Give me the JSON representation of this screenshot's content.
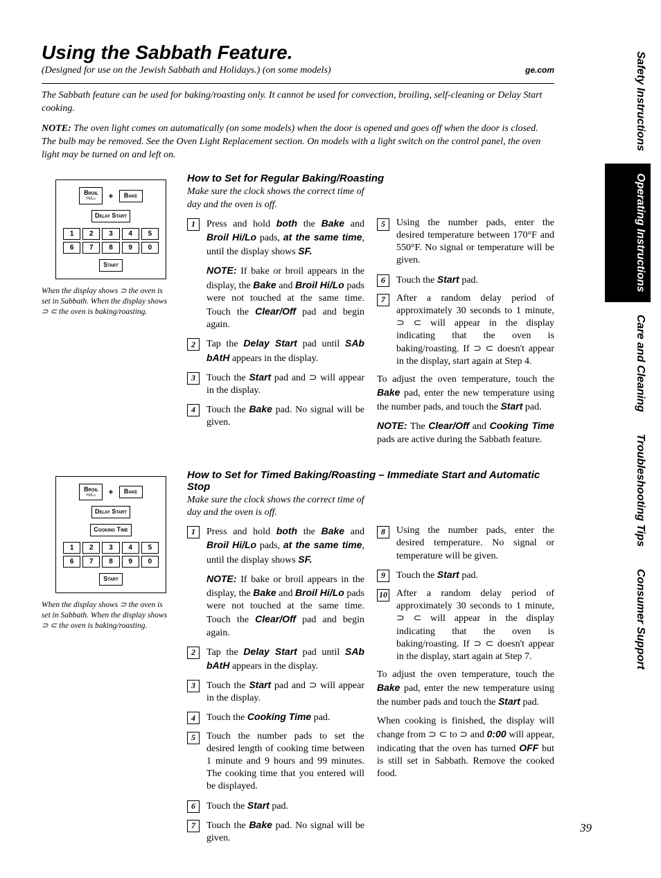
{
  "title": "Using the Sabbath Feature.",
  "subtitle": "(Designed for use on the Jewish Sabbath and Holidays.) (on some models)",
  "website": "ge.com",
  "intro": "The Sabbath feature can be used for baking/roasting only. It cannot be used for convection, broiling, self-cleaning or Delay Start cooking.",
  "intro_note_label": "NOTE:",
  "intro_note": "The oven light comes on automatically (on some models) when the door is opened and goes off when the door is closed. The bulb may be removed. See the Oven Light Replacement section. On models with a light switch on the control panel, the oven light may be turned on and left on.",
  "panel": {
    "broil": "Broil",
    "broil_sub": "Hi/Lo",
    "bake": "Bake",
    "delay": "Delay Start",
    "cooking": "Cooking Time",
    "start": "Start",
    "keys": [
      "1",
      "2",
      "3",
      "4",
      "5",
      "6",
      "7",
      "8",
      "9",
      "0"
    ]
  },
  "panel_caption": "When the display shows ⊃ the oven is set in Sabbath. When the display shows ⊃ ⊂ the oven is baking/roasting.",
  "sec1": {
    "head": "How to Set for Regular Baking/Roasting",
    "intro": "Make sure the clock shows the correct time of day and the oven is off.",
    "s1a": "Press and hold ",
    "s1b": "both",
    "s1c": " the ",
    "s1d": "Bake",
    "s1e": " and ",
    "s1f": "Broil Hi/Lo",
    "s1g": " pads, ",
    "s1h": "at the same time",
    "s1i": ", until the display shows ",
    "s1j": "SF.",
    "note1_lbl": "NOTE:",
    "note1a": "If bake or broil appears in the display, the ",
    "note1b": "Bake",
    "note1c": " and ",
    "note1d": "Broil Hi/Lo",
    "note1e": " pads were not touched at the same time. Touch the ",
    "note1f": "Clear/Off",
    "note1g": " pad and begin again.",
    "s2a": "Tap the ",
    "s2b": "Delay Start",
    "s2c": " pad until ",
    "s2d": "SAb bAtH",
    "s2e": " appears in the display.",
    "s3a": "Touch the ",
    "s3b": "Start",
    "s3c": " pad and ⊃ will appear in the display.",
    "s4a": "Touch the ",
    "s4b": "Bake",
    "s4c": " pad. No signal will be given.",
    "s5": "Using the number pads, enter the desired temperature between 170°F and 550°F. No signal or temperature will be given.",
    "s6a": "Touch the ",
    "s6b": "Start",
    "s6c": " pad.",
    "s7": "After a random delay period of approximately 30 seconds to 1 minute,  ⊃ ⊂ will appear in the display indicating that the oven is baking/roasting. If ⊃ ⊂ doesn't appear in the display, start again at Step 4.",
    "adj1a": "To adjust the oven temperature, touch the ",
    "adj1b": "Bake",
    "adj1c": " pad, enter the new temperature using the number pads, and touch the ",
    "adj1d": "Start",
    "adj1e": " pad.",
    "fnote_lbl": "NOTE:",
    "fnote_a": "The ",
    "fnote_b": "Clear/Off",
    "fnote_c": " and ",
    "fnote_d": "Cooking Time",
    "fnote_e": " pads are active during the Sabbath feature."
  },
  "sec2": {
    "head": "How to Set for Timed Baking/Roasting – Immediate Start and Automatic Stop",
    "intro": "Make sure the clock shows the correct time of day and the oven is off.",
    "s4a": "Touch the ",
    "s4b": "Cooking Time",
    "s4c": " pad.",
    "s5": "Touch the number pads to set the desired length of cooking time between 1 minute and 9 hours and 99 minutes. The cooking time that you entered will be displayed.",
    "s6a": "Touch the ",
    "s6b": "Start",
    "s6c": " pad.",
    "s7a": "Touch the ",
    "s7b": "Bake",
    "s7c": " pad. No signal will be given.",
    "s8": "Using the number pads, enter the desired temperature. No signal or temperature will be given.",
    "s9a": "Touch the ",
    "s9b": "Start",
    "s9c": " pad.",
    "s10": "After a random delay period of approximately 30 seconds to 1 minute,  ⊃ ⊂ will appear in the display indicating that the oven is baking/roasting. If ⊃ ⊂ doesn't appear in the display, start again at Step 7.",
    "adj1a": "To adjust the oven temperature, touch the ",
    "adj1b": "Bake",
    "adj1c": " pad, enter the new temperature using the number pads and touch the ",
    "adj1d": "Start",
    "adj1e": " pad.",
    "fin_a": "When cooking is finished, the display will change from ⊃ ⊂ to ⊃ and ",
    "fin_b": "0:00",
    "fin_c": " will appear, indicating that the oven has turned ",
    "fin_d": "OFF",
    "fin_e": " but is still set in Sabbath. Remove the cooked food."
  },
  "tabs": {
    "t1": "Safety Instructions",
    "t2": "Operating Instructions",
    "t3": "Care and Cleaning",
    "t4": "Troubleshooting Tips",
    "t5": "Consumer Support"
  },
  "pagenum": "39"
}
